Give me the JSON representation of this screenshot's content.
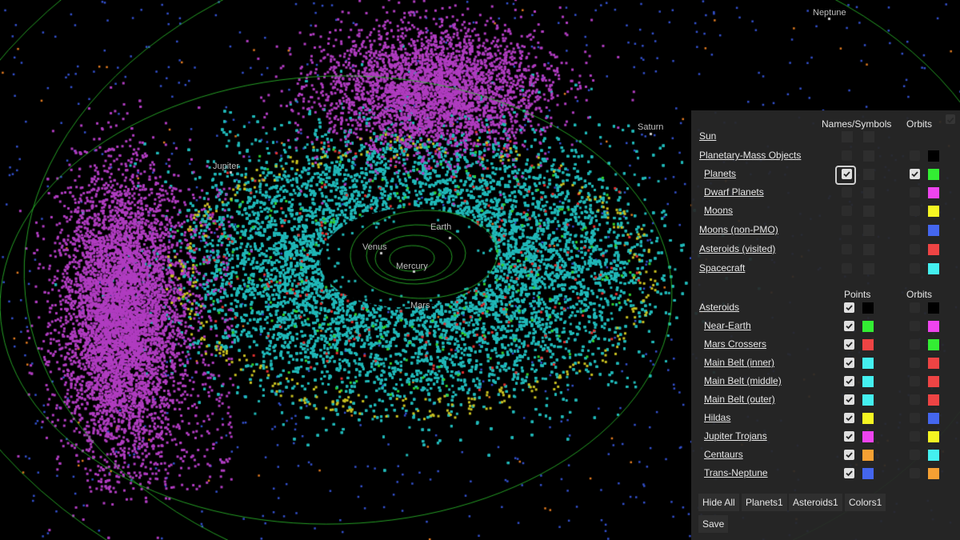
{
  "planet_labels": [
    {
      "name": "Neptune"
    },
    {
      "name": "Saturn"
    },
    {
      "name": "Jupiter"
    },
    {
      "name": "Earth"
    },
    {
      "name": "Venus"
    },
    {
      "name": "Mercury"
    },
    {
      "name": "Mars"
    }
  ],
  "panel": {
    "header_names": "Names/Symbols",
    "header_orbits": "Orbits",
    "header_points": "Points",
    "header_orbits2": "Orbits",
    "pmo_rows": [
      {
        "label": "Sun",
        "orbit_color": null
      },
      {
        "label": "Planetary-Mass Objects",
        "orbit_color": "#000000"
      },
      {
        "label": "Planets",
        "orbit_color": "#33ee33",
        "names_checked": true,
        "orbit_checked": true
      },
      {
        "label": "Dwarf Planets",
        "orbit_color": "#ee44ee"
      },
      {
        "label": "Moons",
        "orbit_color": "#f5f522"
      },
      {
        "label": "Moons (non-PMO)",
        "orbit_color": "#4466ee"
      },
      {
        "label": "Asteroids (visited)",
        "orbit_color": "#ee4444"
      },
      {
        "label": "Spacecraft",
        "orbit_color": "#44f0f0"
      }
    ],
    "asteroid_rows": [
      {
        "label": "Asteroids",
        "point_color": "#000000",
        "orbit_color": "#000000"
      },
      {
        "label": "Near-Earth",
        "point_color": "#33ee33",
        "orbit_color": "#ee44ee"
      },
      {
        "label": "Mars Crossers",
        "point_color": "#ee4444",
        "orbit_color": "#33ee33"
      },
      {
        "label": "Main Belt (inner)",
        "point_color": "#44f0f0",
        "orbit_color": "#ee4444"
      },
      {
        "label": "Main Belt (middle)",
        "point_color": "#44f0f0",
        "orbit_color": "#ee4444"
      },
      {
        "label": "Main Belt (outer)",
        "point_color": "#44f0f0",
        "orbit_color": "#ee4444"
      },
      {
        "label": "Hildas",
        "point_color": "#f5f522",
        "orbit_color": "#4466ee"
      },
      {
        "label": "Jupiter Trojans",
        "point_color": "#ee44ee",
        "orbit_color": "#f5f522"
      },
      {
        "label": "Centaurs",
        "point_color": "#f5a033",
        "orbit_color": "#44f0f0"
      },
      {
        "label": "Trans-Neptune",
        "point_color": "#4466ee",
        "orbit_color": "#f5a033"
      }
    ],
    "buttons": {
      "hide_all": "Hide All",
      "planets1": "Planets1",
      "asteroids1": "Asteroids1",
      "colors1": "Colors1",
      "save": "Save"
    }
  },
  "colors": {
    "main_belt": "#20b8b8",
    "trojans": "#b03cc0",
    "hildas": "#c8c020",
    "tno": "#3350cc",
    "orbit_line": "#2ec82e",
    "panel_bg": "#282828"
  }
}
